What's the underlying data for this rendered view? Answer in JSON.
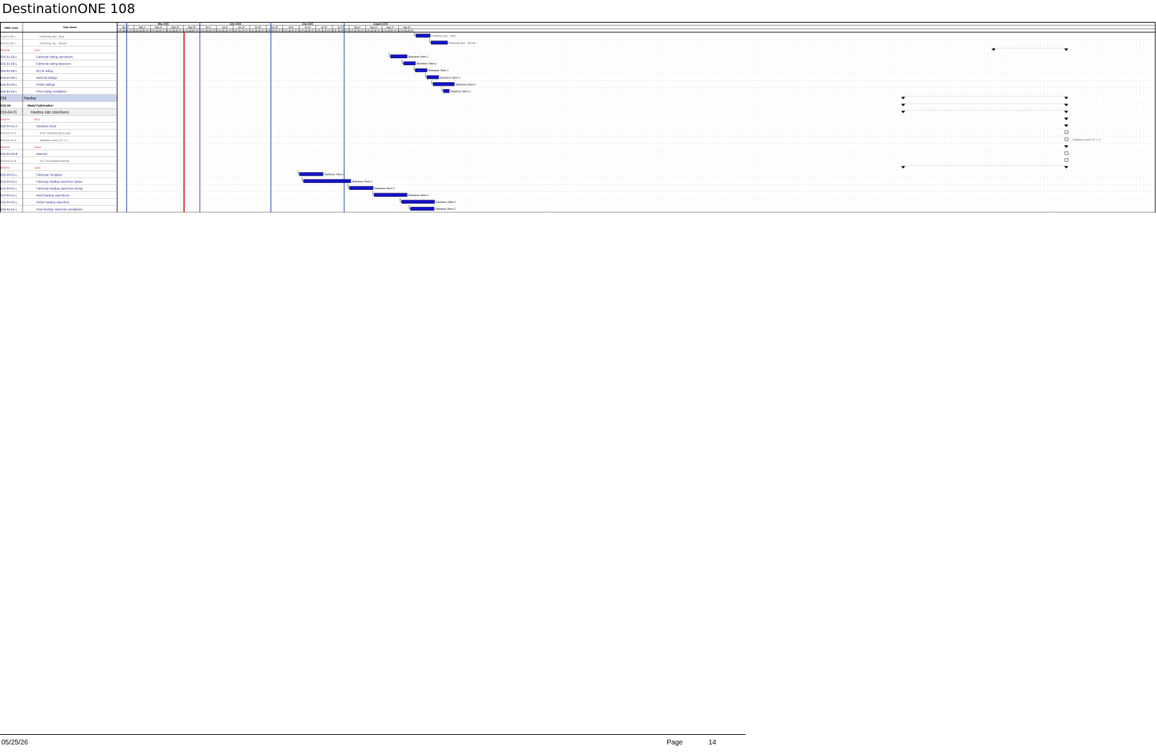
{
  "title": "DestinationONE 108",
  "header": {
    "col_wbs": "WBS Code",
    "col_task": "Task Name",
    "months": [
      "May 2026",
      "June 2026",
      "July 2026",
      "August 2026"
    ],
    "weeks": [
      "Apr 27",
      "May 4",
      "May 11",
      "May 18",
      "May 25",
      "Jun 1",
      "Jun 8",
      "Jun 15",
      "Jun 22",
      "Jun 29",
      "Jul 6",
      "Jul 13",
      "Jul 20",
      "Jul 27",
      "Aug 3",
      "Aug 10",
      "Aug 17",
      "Aug 24"
    ],
    "days": [
      "Mon",
      "Tue",
      "Wed",
      "Thu",
      "Fri"
    ]
  },
  "rows": [
    {
      "wbs": "015-01-06-1",
      "name": "Polishing disc - Blue",
      "style": "sub",
      "bar": null,
      "label": "Polishing disc - Blue"
    },
    {
      "wbs": "015-01-06-1",
      "name": "Polishing disc - Brown",
      "style": "sub",
      "bar": null,
      "label": "Polishing disc - Brown"
    },
    {
      "wbs": "MS0006",
      "name": "Labor",
      "style": "milestone",
      "bar": null,
      "label": ""
    },
    {
      "wbs": "015-01-06-L",
      "name": "Fabricate railing stanchions",
      "style": "task",
      "bar": null,
      "label": "Stainless Steel 2"
    },
    {
      "wbs": "015-01-06-L",
      "name": "Fabricate railing fasteners",
      "style": "task",
      "bar": null,
      "label": "Stainless Steel 2"
    },
    {
      "wbs": "015-01-06-L",
      "name": "Dry fit railing",
      "style": "task",
      "bar": null,
      "label": "Stainless Steel 2"
    },
    {
      "wbs": "015-01-06-L",
      "name": "Weld all railings",
      "style": "task",
      "bar": null,
      "label": "Stainless Steel 2"
    },
    {
      "wbs": "015-01-06-L",
      "name": "Polish railings",
      "style": "task",
      "bar": null,
      "label": "Stainless Steel 2"
    },
    {
      "wbs": "015-01-06-L",
      "name": "Final railing installation",
      "style": "task",
      "bar": null,
      "label": "Stainless Steel 2"
    },
    {
      "wbs": "016",
      "name": "Hardtop",
      "style": "summary",
      "bar": null,
      "label": ""
    },
    {
      "wbs": "016-04",
      "name": "Metal Fabrication",
      "style": "group",
      "bar": null,
      "label": ""
    },
    {
      "wbs": "016-04-01",
      "name": "Hardtop side stanchions",
      "style": "group2",
      "bar": null,
      "label": ""
    },
    {
      "wbs": "MS0014",
      "name": "Parts",
      "style": "milestone",
      "bar": null,
      "label": ""
    },
    {
      "wbs": "016-04-01-A",
      "name": "Stainless Steel",
      "style": "task",
      "bar": null,
      "label": ""
    },
    {
      "wbs": "016-04-01-A",
      "name": "5/16\" stainless steel plate",
      "style": "sub",
      "bar": null,
      "label": ""
    },
    {
      "wbs": "016-04-01-A",
      "name": "Stainless steel 1.5\" x 1\"",
      "style": "sub",
      "bar": null,
      "label": "Stainless steel 1.5\" x 1\""
    },
    {
      "wbs": "MS0016",
      "name": "Polish",
      "style": "milestone",
      "bar": null,
      "label": ""
    },
    {
      "wbs": "016-04-01-B",
      "name": "Material",
      "style": "task",
      "bar": null,
      "label": ""
    },
    {
      "wbs": "016-04-01-B",
      "name": "1/2\" 316 polished tubing",
      "style": "sub",
      "bar": null,
      "label": ""
    },
    {
      "wbs": "MS0016",
      "name": "Labor",
      "style": "milestone",
      "bar": null,
      "label": ""
    },
    {
      "wbs": "016-04-01-L",
      "name": "Fabricate Template",
      "style": "task",
      "bar": null,
      "label": "Stainless Steel 2"
    },
    {
      "wbs": "016-04-01-L",
      "name": "Fabricate hardtop stanchion plates",
      "style": "task",
      "bar": null,
      "label": "Stainless Steel 2"
    },
    {
      "wbs": "016-04-01-L",
      "name": "Fabricate hardtop stanchion tubing",
      "style": "task",
      "bar": null,
      "label": "Stainless Steel 2"
    },
    {
      "wbs": "016-04-01-L",
      "name": "Weld hardtop stanchions",
      "style": "task",
      "bar": null,
      "label": "Stainless Steel 2"
    },
    {
      "wbs": "016-04-01-L",
      "name": "Polish hardtop stanchion",
      "style": "task",
      "bar": null,
      "label": "Stainless Steel 2"
    },
    {
      "wbs": "016-04-01-L",
      "name": "Final hardtop stanchion installation",
      "style": "task",
      "bar": null,
      "label": "Stainless Steel 2"
    }
  ],
  "footer": {
    "date": "05/25/26",
    "page_label": "Page",
    "page_number": "14"
  },
  "colors": {
    "bar": "#1414c8",
    "summary_row": "#ccd4ec",
    "group_row": "#f0f0f0",
    "wbs_text": "#1a1a8c",
    "task_text": "#3a2a8c",
    "milestone_text": "#cc2222",
    "sub_text": "#555555",
    "today_line": "#d40000",
    "month_line": "#1a3aa8"
  }
}
